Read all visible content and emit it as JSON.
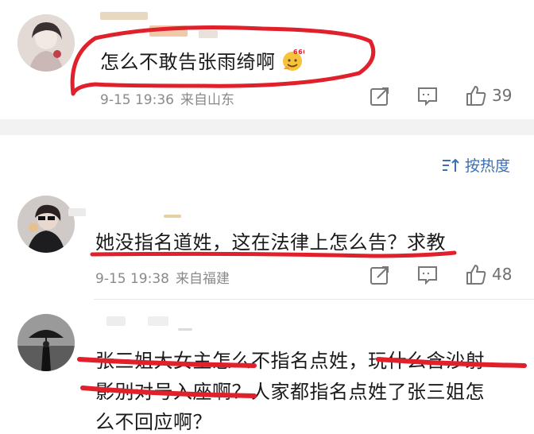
{
  "comments": [
    {
      "text": "怎么不敢告张雨绮啊",
      "emoji": "666",
      "time": "9-15 19:36",
      "location": "来自山东",
      "likes": "39"
    },
    {
      "text": "她没指名道姓，这在法律上怎么告？求教",
      "time": "9-15 19:38",
      "location": "来自福建",
      "likes": "48"
    },
    {
      "text_line1": "张三姐大女主怎么不指名点姓，玩什么含沙射",
      "text_line2": "影别对号入座啊？人家都指名点姓了张三姐怎",
      "text_line3": "么不回应啊？"
    }
  ],
  "sort": {
    "label": "按热度"
  },
  "icons": {
    "share": "share-icon",
    "comment": "comment-icon",
    "like": "thumbs-up-icon",
    "sort": "sort-icon"
  },
  "colors": {
    "annotation_red": "#e0202a",
    "link_blue": "#3a6fb5",
    "meta_gray": "#8a8a8a",
    "band_gray": "#f2f2f2"
  }
}
